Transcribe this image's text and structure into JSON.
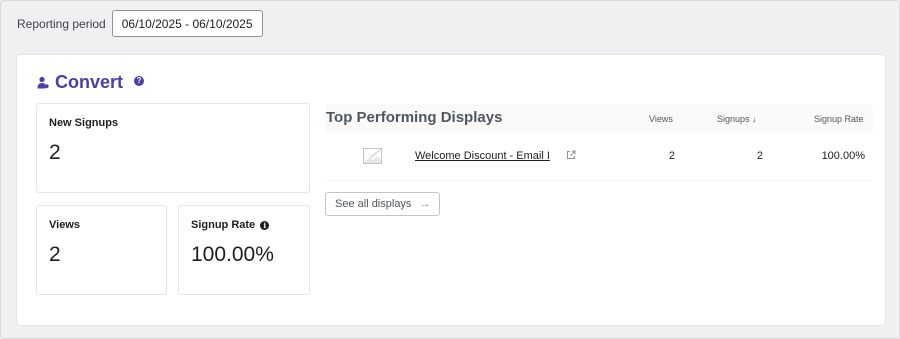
{
  "filter": {
    "period_label": "Reporting period",
    "period_value": "06/10/2025 - 06/10/2025"
  },
  "convert": {
    "title": "Convert",
    "help_glyph": "?",
    "metrics": {
      "new_signups": {
        "label": "New Signups",
        "value": "2"
      },
      "views": {
        "label": "Views",
        "value": "2"
      },
      "signup_rate": {
        "label": "Signup Rate",
        "value": "100.00%",
        "info_glyph": "i"
      }
    }
  },
  "top_displays": {
    "title": "Top Performing Displays",
    "columns": {
      "views": "Views",
      "signups": "Signups ↓",
      "rate": "Signup Rate"
    },
    "rows": [
      {
        "name": "Welcome Discount - Email I",
        "views": "2",
        "signups": "2",
        "rate": "100.00%"
      }
    ],
    "see_all_label": "See all displays",
    "see_all_arrow": "→"
  },
  "colors": {
    "brand": "#4b3ea8",
    "text": "#1e1e1e",
    "muted": "#50575e"
  },
  "icons": {
    "convert": "user-icon",
    "help": "help-icon",
    "info": "info-icon",
    "thumbnail": "image-placeholder-icon",
    "external": "external-link-icon"
  }
}
